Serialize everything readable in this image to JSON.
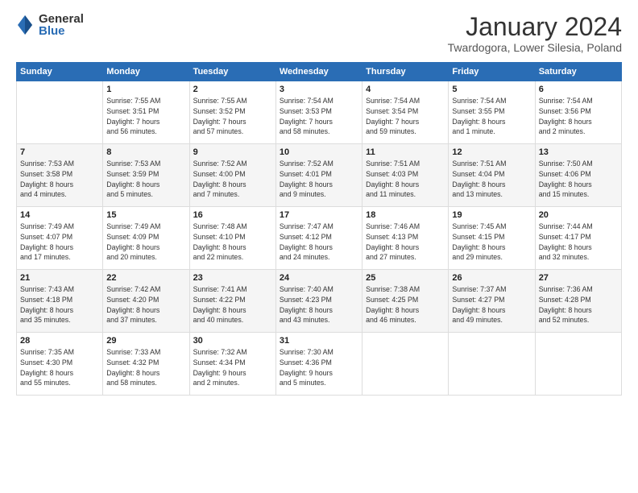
{
  "logo": {
    "general": "General",
    "blue": "Blue"
  },
  "header": {
    "month": "January 2024",
    "location": "Twardogora, Lower Silesia, Poland"
  },
  "weekdays": [
    "Sunday",
    "Monday",
    "Tuesday",
    "Wednesday",
    "Thursday",
    "Friday",
    "Saturday"
  ],
  "weeks": [
    [
      null,
      {
        "day": "1",
        "sunrise": "7:55 AM",
        "sunset": "3:51 PM",
        "daylight": "7 hours and 56 minutes."
      },
      {
        "day": "2",
        "sunrise": "7:55 AM",
        "sunset": "3:52 PM",
        "daylight": "7 hours and 57 minutes."
      },
      {
        "day": "3",
        "sunrise": "7:54 AM",
        "sunset": "3:53 PM",
        "daylight": "7 hours and 58 minutes."
      },
      {
        "day": "4",
        "sunrise": "7:54 AM",
        "sunset": "3:54 PM",
        "daylight": "7 hours and 59 minutes."
      },
      {
        "day": "5",
        "sunrise": "7:54 AM",
        "sunset": "3:55 PM",
        "daylight": "8 hours and 1 minute."
      },
      {
        "day": "6",
        "sunrise": "7:54 AM",
        "sunset": "3:56 PM",
        "daylight": "8 hours and 2 minutes."
      }
    ],
    [
      {
        "day": "7",
        "sunrise": "7:53 AM",
        "sunset": "3:58 PM",
        "daylight": "8 hours and 4 minutes."
      },
      {
        "day": "8",
        "sunrise": "7:53 AM",
        "sunset": "3:59 PM",
        "daylight": "8 hours and 5 minutes."
      },
      {
        "day": "9",
        "sunrise": "7:52 AM",
        "sunset": "4:00 PM",
        "daylight": "8 hours and 7 minutes."
      },
      {
        "day": "10",
        "sunrise": "7:52 AM",
        "sunset": "4:01 PM",
        "daylight": "8 hours and 9 minutes."
      },
      {
        "day": "11",
        "sunrise": "7:51 AM",
        "sunset": "4:03 PM",
        "daylight": "8 hours and 11 minutes."
      },
      {
        "day": "12",
        "sunrise": "7:51 AM",
        "sunset": "4:04 PM",
        "daylight": "8 hours and 13 minutes."
      },
      {
        "day": "13",
        "sunrise": "7:50 AM",
        "sunset": "4:06 PM",
        "daylight": "8 hours and 15 minutes."
      }
    ],
    [
      {
        "day": "14",
        "sunrise": "7:49 AM",
        "sunset": "4:07 PM",
        "daylight": "8 hours and 17 minutes."
      },
      {
        "day": "15",
        "sunrise": "7:49 AM",
        "sunset": "4:09 PM",
        "daylight": "8 hours and 20 minutes."
      },
      {
        "day": "16",
        "sunrise": "7:48 AM",
        "sunset": "4:10 PM",
        "daylight": "8 hours and 22 minutes."
      },
      {
        "day": "17",
        "sunrise": "7:47 AM",
        "sunset": "4:12 PM",
        "daylight": "8 hours and 24 minutes."
      },
      {
        "day": "18",
        "sunrise": "7:46 AM",
        "sunset": "4:13 PM",
        "daylight": "8 hours and 27 minutes."
      },
      {
        "day": "19",
        "sunrise": "7:45 AM",
        "sunset": "4:15 PM",
        "daylight": "8 hours and 29 minutes."
      },
      {
        "day": "20",
        "sunrise": "7:44 AM",
        "sunset": "4:17 PM",
        "daylight": "8 hours and 32 minutes."
      }
    ],
    [
      {
        "day": "21",
        "sunrise": "7:43 AM",
        "sunset": "4:18 PM",
        "daylight": "8 hours and 35 minutes."
      },
      {
        "day": "22",
        "sunrise": "7:42 AM",
        "sunset": "4:20 PM",
        "daylight": "8 hours and 37 minutes."
      },
      {
        "day": "23",
        "sunrise": "7:41 AM",
        "sunset": "4:22 PM",
        "daylight": "8 hours and 40 minutes."
      },
      {
        "day": "24",
        "sunrise": "7:40 AM",
        "sunset": "4:23 PM",
        "daylight": "8 hours and 43 minutes."
      },
      {
        "day": "25",
        "sunrise": "7:38 AM",
        "sunset": "4:25 PM",
        "daylight": "8 hours and 46 minutes."
      },
      {
        "day": "26",
        "sunrise": "7:37 AM",
        "sunset": "4:27 PM",
        "daylight": "8 hours and 49 minutes."
      },
      {
        "day": "27",
        "sunrise": "7:36 AM",
        "sunset": "4:28 PM",
        "daylight": "8 hours and 52 minutes."
      }
    ],
    [
      {
        "day": "28",
        "sunrise": "7:35 AM",
        "sunset": "4:30 PM",
        "daylight": "8 hours and 55 minutes."
      },
      {
        "day": "29",
        "sunrise": "7:33 AM",
        "sunset": "4:32 PM",
        "daylight": "8 hours and 58 minutes."
      },
      {
        "day": "30",
        "sunrise": "7:32 AM",
        "sunset": "4:34 PM",
        "daylight": "9 hours and 2 minutes."
      },
      {
        "day": "31",
        "sunrise": "7:30 AM",
        "sunset": "4:36 PM",
        "daylight": "9 hours and 5 minutes."
      },
      null,
      null,
      null
    ]
  ]
}
